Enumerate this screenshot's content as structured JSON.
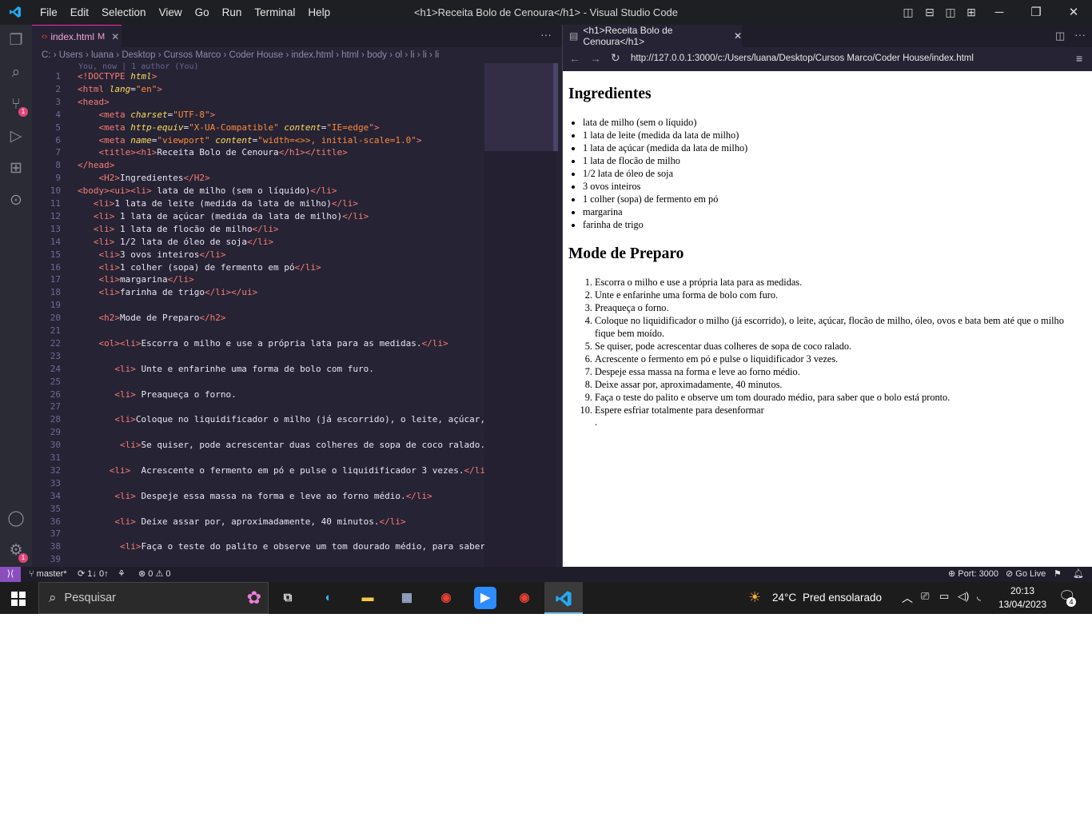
{
  "titlebar": {
    "menus": [
      "File",
      "Edit",
      "Selection",
      "View",
      "Go",
      "Run",
      "Terminal",
      "Help"
    ],
    "title": "<h1>Receita Bolo de Cenoura</h1> - Visual Studio Code"
  },
  "editor": {
    "tab_label": "index.html",
    "tab_modified": "M",
    "breadcrumbs": "C: › Users › luana › Desktop › Cursos Marco › Coder House › index.html › html › body › ol › li › li › li",
    "blame": "You, now | 1 author (You)",
    "lines": [
      {
        "n": "1",
        "html": "<span class=\"t\">&lt;!DOCTYPE</span> <span class=\"at\">html</span><span class=\"t\">&gt;</span>"
      },
      {
        "n": "2",
        "html": "<span class=\"t\">&lt;html</span> <span class=\"at\">lang</span>=<span class=\"st\">\"en\"</span><span class=\"t\">&gt;</span>"
      },
      {
        "n": "3",
        "html": "<span class=\"t\">&lt;head&gt;</span>"
      },
      {
        "n": "4",
        "html": "    <span class=\"t\">&lt;meta</span> <span class=\"at\">charset</span>=<span class=\"st\">\"UTF-8\"</span><span class=\"t\">&gt;</span>"
      },
      {
        "n": "5",
        "html": "    <span class=\"t\">&lt;meta</span> <span class=\"at\">http-equiv</span>=<span class=\"st\">\"X-UA-Compatible\"</span> <span class=\"at\">content</span>=<span class=\"st\">\"IE=edge\"</span><span class=\"t\">&gt;</span>"
      },
      {
        "n": "6",
        "html": "    <span class=\"t\">&lt;meta</span> <span class=\"at\">name</span>=<span class=\"st\">\"viewport\"</span> <span class=\"at\">content</span>=<span class=\"st\">\"width=&lt;&gt;&gt;, initial-scale=1.0\"</span><span class=\"t\">&gt;</span>"
      },
      {
        "n": "7",
        "html": "    <span class=\"t\">&lt;title&gt;&lt;h1&gt;</span>Receita Bolo de Cenoura<span class=\"t\">&lt;/h1&gt;&lt;/title&gt;</span>"
      },
      {
        "n": "8",
        "html": "<span class=\"t\">&lt;/head&gt;</span>"
      },
      {
        "n": "9",
        "html": "    <span class=\"t\">&lt;H2&gt;</span>Ingredientes<span class=\"t\">&lt;/H2&gt;</span>"
      },
      {
        "n": "10",
        "html": "<span class=\"t\">&lt;body&gt;&lt;ui&gt;&lt;li&gt;</span> lata de milho (sem o líquido)<span class=\"t\">&lt;/li&gt;</span>"
      },
      {
        "n": "11",
        "html": "   <span class=\"t\">&lt;li&gt;</span>1 lata de leite (medida da lata de milho)<span class=\"t\">&lt;/li&gt;</span>"
      },
      {
        "n": "12",
        "html": "   <span class=\"t\">&lt;li&gt;</span> 1 lata de açúcar (medida da lata de milho)<span class=\"t\">&lt;/li&gt;</span>"
      },
      {
        "n": "13",
        "html": "   <span class=\"t\">&lt;li&gt;</span> 1 lata de flocão de milho<span class=\"t\">&lt;/li&gt;</span>"
      },
      {
        "n": "14",
        "html": "   <span class=\"t\">&lt;li&gt;</span> 1/2 lata de óleo de soja<span class=\"t\">&lt;/li&gt;</span>"
      },
      {
        "n": "15",
        "html": "    <span class=\"t\">&lt;li&gt;</span>3 ovos inteiros<span class=\"t\">&lt;/li&gt;</span>"
      },
      {
        "n": "16",
        "html": "    <span class=\"t\">&lt;li&gt;</span>1 colher (sopa) de fermento em pó<span class=\"t\">&lt;/li&gt;</span>"
      },
      {
        "n": "17",
        "html": "    <span class=\"t\">&lt;li&gt;</span>margarina<span class=\"t\">&lt;/li&gt;</span>"
      },
      {
        "n": "18",
        "html": "    <span class=\"t\">&lt;li&gt;</span>farinha de trigo<span class=\"t\">&lt;/li&gt;&lt;/ui&gt;</span>"
      },
      {
        "n": "19",
        "html": ""
      },
      {
        "n": "20",
        "html": "    <span class=\"t\">&lt;h2&gt;</span>Mode de Preparo<span class=\"t\">&lt;/h2&gt;</span>"
      },
      {
        "n": "21",
        "html": ""
      },
      {
        "n": "22",
        "html": "    <span class=\"t\">&lt;ol&gt;&lt;li&gt;</span>Escorra o milho e use a própria lata para as medidas.<span class=\"t\">&lt;/li&gt;</span>"
      },
      {
        "n": "23",
        "html": ""
      },
      {
        "n": "24",
        "html": "       <span class=\"t\">&lt;li&gt;</span> Unte e enfarinhe uma forma de bolo com furo."
      },
      {
        "n": "25",
        "html": ""
      },
      {
        "n": "26",
        "html": "       <span class=\"t\">&lt;li&gt;</span> Preaqueça o forno."
      },
      {
        "n": "27",
        "html": ""
      },
      {
        "n": "28",
        "html": "       <span class=\"t\">&lt;li&gt;</span>Coloque no liquidificador o milho (já escorrido), o leite, açúcar, f"
      },
      {
        "n": "29",
        "html": ""
      },
      {
        "n": "30",
        "html": "        <span class=\"t\">&lt;li&gt;</span>Se quiser, pode acrescentar duas colheres de sopa de coco ralado.<span class=\"t\">&lt;/</span>"
      },
      {
        "n": "31",
        "html": ""
      },
      {
        "n": "32",
        "html": "      <span class=\"t\">&lt;li&gt;</span>  Acrescente o fermento em pó e pulse o liquidificador 3 vezes.<span class=\"t\">&lt;/li&gt;</span>"
      },
      {
        "n": "33",
        "html": ""
      },
      {
        "n": "34",
        "html": "       <span class=\"t\">&lt;li&gt;</span> Despeje essa massa na forma e leve ao forno médio.<span class=\"t\">&lt;/li&gt;</span>"
      },
      {
        "n": "35",
        "html": ""
      },
      {
        "n": "36",
        "html": "       <span class=\"t\">&lt;li&gt;</span> Deixe assar por, aproximadamente, 40 minutos.<span class=\"t\">&lt;/li&gt;</span>"
      },
      {
        "n": "37",
        "html": ""
      },
      {
        "n": "38",
        "html": "        <span class=\"t\">&lt;li&gt;</span>Faça o teste do palito e observe um tom dourado médio, para saber qu"
      },
      {
        "n": "39",
        "html": ""
      }
    ]
  },
  "preview": {
    "tab_label": "<h1>Receita Bolo de Cenoura</h1>",
    "url": "http://127.0.0.1:3000/c:/Users/luana/Desktop/Cursos Marco/Coder House/index.html",
    "h_ingredients": "Ingredientes",
    "ingredients": [
      "lata de milho (sem o líquido)",
      "1 lata de leite (medida da lata de milho)",
      "1 lata de açúcar (medida da lata de milho)",
      "1 lata de flocão de milho",
      "1/2 lata de óleo de soja",
      "3 ovos inteiros",
      "1 colher (sopa) de fermento em pó",
      "margarina",
      "farinha de trigo"
    ],
    "h_preparo": "Mode de Preparo",
    "steps": [
      "Escorra o milho e use a própria lata para as medidas.",
      "Unte e enfarinhe uma forma de bolo com furo.",
      "Preaqueça o forno.",
      "Coloque no liquidificador o milho (já escorrido), o leite, açúcar, flocão de milho, óleo, ovos e bata bem até que o milho fique bem moído.",
      "Se quiser, pode acrescentar duas colheres de sopa de coco ralado.",
      "Acrescente o fermento em pó e pulse o liquidificador 3 vezes.",
      "Despeje essa massa na forma e leve ao forno médio.",
      "Deixe assar por, aproximadamente, 40 minutos.",
      "Faça o teste do palito e observe um tom dourado médio, para saber que o bolo está pronto.",
      "Espere esfriar totalmente para desenformar"
    ],
    "trailing_dot": "."
  },
  "statusbar": {
    "branch": "master*",
    "sync": "1↓ 0↑",
    "problems": "⊗ 0 ⚠ 0",
    "port": "Port: 3000",
    "golive": "Go Live"
  },
  "taskbar": {
    "search_placeholder": "Pesquisar",
    "weather_temp": "24°C",
    "weather_desc": "Pred ensolarado",
    "time": "20:13",
    "date": "13/04/2023",
    "notif_count": "4"
  },
  "badges": {
    "scm": "1",
    "settings": "1"
  },
  "colors": {
    "accent": "#f92aad",
    "status_remote": "#8b4fbd",
    "editor_bg": "#262335"
  },
  "icons": [
    "vscode-logo-icon",
    "explorer-icon",
    "search-icon",
    "source-control-icon",
    "run-debug-icon",
    "extensions-icon",
    "git-graph-icon",
    "account-icon",
    "settings-gear-icon"
  ]
}
